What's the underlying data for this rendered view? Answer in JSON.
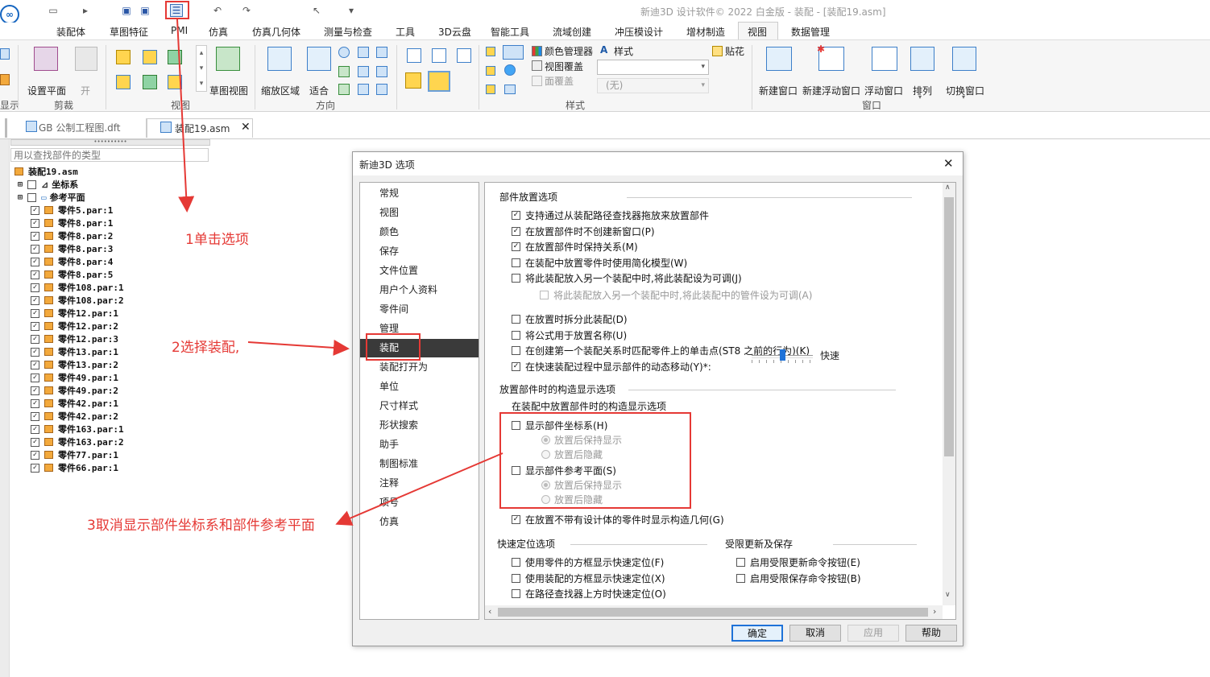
{
  "app": {
    "title": "新迪3D 设计软件© 2022 白金版 - 装配 - [装配19.asm]"
  },
  "menu": {
    "tabs": [
      "装配体",
      "草图特征",
      "PMI",
      "仿真",
      "仿真几何体",
      "测量与检查",
      "工具",
      "3D云盘",
      "智能工具",
      "流域创建",
      "冲压模设计",
      "增材制造",
      "视图",
      "数据管理"
    ],
    "active": "视图"
  },
  "ribbon": {
    "left_cut": "显示",
    "set_plane": "设置平面",
    "open": "开",
    "clip_group": "剪裁",
    "view_group": "视图",
    "sketch_view": "草图视图",
    "zoom_area": "缩放区域",
    "fit": "适合",
    "orient_group": "方向",
    "color_manager": "颜色管理器",
    "view_overlay": "视图覆盖",
    "face_overlay": "面覆盖",
    "style_label": "样式",
    "decal": "贴花",
    "style_value": "(无)",
    "style_group": "样式",
    "new_window": "新建窗口",
    "new_float_window": "新建浮动窗口",
    "float_window": "浮动窗口",
    "arrange": "排列",
    "switch_window": "切换窗口",
    "window_group": "窗口"
  },
  "doctabs": [
    {
      "label": "GB 公制工程图.dft"
    },
    {
      "label": "装配19.asm"
    }
  ],
  "tree": {
    "search_placeholder": "用以查找部件的类型",
    "root": "装配19.asm",
    "nodes": [
      "坐标系",
      "参考平面"
    ],
    "parts": [
      "零件5.par:1",
      "零件8.par:1",
      "零件8.par:2",
      "零件8.par:3",
      "零件8.par:4",
      "零件8.par:5",
      "零件108.par:1",
      "零件108.par:2",
      "零件12.par:1",
      "零件12.par:2",
      "零件12.par:3",
      "零件13.par:1",
      "零件13.par:2",
      "零件49.par:1",
      "零件49.par:2",
      "零件42.par:1",
      "零件42.par:2",
      "零件163.par:1",
      "零件163.par:2",
      "零件77.par:1",
      "零件66.par:1"
    ]
  },
  "annotations": {
    "step1": "1单击选项",
    "step2": "2选择装配,",
    "step3": "3取消显示部件坐标系和部件参考平面"
  },
  "dialog": {
    "title": "新迪3D 选项",
    "categories": [
      "常规",
      "视图",
      "颜色",
      "保存",
      "文件位置",
      "用户个人资料",
      "零件间",
      "管理",
      "装配",
      "装配打开为",
      "单位",
      "尺寸样式",
      "形状搜索",
      "助手",
      "制图标准",
      "注释",
      "项号",
      "仿真"
    ],
    "selected_category": "装配",
    "section1": "部件放置选项",
    "opts1": [
      {
        "label": "支持通过从装配路径查找器拖放来放置部件",
        "checked": true
      },
      {
        "label": "在放置部件时不创建新窗口(P)",
        "checked": true
      },
      {
        "label": "在放置部件时保持关系(M)",
        "checked": true
      },
      {
        "label": "在装配中放置零件时使用简化模型(W)",
        "checked": false
      },
      {
        "label": "将此装配放入另一个装配中时,将此装配设为可调(J)",
        "checked": false
      }
    ],
    "opt_disabled": "将此装配放入另一个装配中时,将此装配中的管件设为可调(A)",
    "opts2": [
      {
        "label": "在放置时拆分此装配(D)",
        "checked": false
      },
      {
        "label": "将公式用于放置名称(U)",
        "checked": false
      },
      {
        "label": "在创建第一个装配关系时匹配零件上的单击点(ST8 之前的行为)(K)",
        "checked": false
      },
      {
        "label": "在快速装配过程中显示部件的动态移动(Y)*:",
        "checked": true
      }
    ],
    "fast_label": "快速",
    "section2": "放置部件时的构造显示选项",
    "subsection2": "在装配中放置部件时的构造显示选项",
    "show_coord": "显示部件坐标系(H)",
    "show_ref": "显示部件参考平面(S)",
    "keep_show": "放置后保持显示",
    "hide_after": "放置后隐藏",
    "opt_no_design": "在放置不带有设计体的零件时显示构造几何(G)",
    "section3": "快速定位选项",
    "opts3": [
      "使用零件的方框显示快速定位(F)",
      "使用装配的方框显示快速定位(X)",
      "在路径查找器上方时快速定位(O)"
    ],
    "section4": "受限更新及保存",
    "opts4": [
      "启用受限更新命令按钮(E)",
      "启用受限保存命令按钮(B)"
    ],
    "buttons": {
      "ok": "确定",
      "cancel": "取消",
      "apply": "应用",
      "help": "帮助"
    }
  }
}
